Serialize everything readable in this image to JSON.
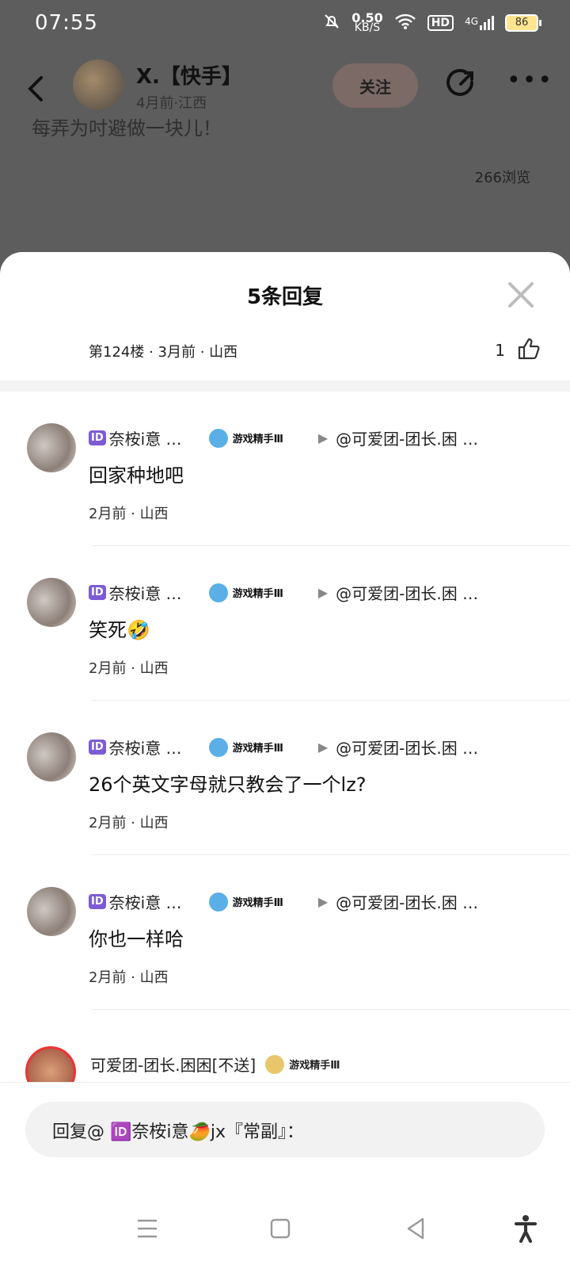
{
  "status_bar": {
    "time": "07:55",
    "net_speed": "0.50",
    "net_unit": "KB/S",
    "hd": "HD",
    "signal": "4G",
    "battery": "86"
  },
  "header": {
    "user_name": "X.【快手】",
    "user_meta": "4月前·江西",
    "follow_label": "关注",
    "bg_text": "每弄为吋避做一块儿！",
    "views": "266浏览"
  },
  "sheet": {
    "title": "5条回复",
    "floor_info": "第124楼 · 3月前 · 山西",
    "like_count": "1"
  },
  "replies": [
    {
      "badge": "ID",
      "user": "奈桉i意 …",
      "game_badge": "游戏精手Ⅲ",
      "mention": "@可爱团-团长.困 …",
      "content": "回家种地吧",
      "meta": "2月前 · 山西"
    },
    {
      "badge": "ID",
      "user": "奈桉i意 …",
      "game_badge": "游戏精手Ⅲ",
      "mention": "@可爱团-团长.困 …",
      "content": "笑死🤣",
      "meta": "2月前 · 山西"
    },
    {
      "badge": "ID",
      "user": "奈桉i意 …",
      "game_badge": "游戏精手Ⅲ",
      "mention": "@可爱团-团长.困 …",
      "content": "26个英文字母就只教会了一个lz?",
      "meta": "2月前 · 山西"
    },
    {
      "badge": "ID",
      "user": "奈桉i意 …",
      "game_badge": "游戏精手Ⅲ",
      "mention": "@可爱团-团长.困 …",
      "content": "你也一样哈",
      "meta": "2月前 · 山西"
    }
  ],
  "reply5": {
    "user": "可爱团-团长.困困[不送]",
    "game_badge": "游戏精手Ⅲ"
  },
  "input": {
    "placeholder": "回复@ 🆔奈桉i意🥭jx『常副』："
  }
}
